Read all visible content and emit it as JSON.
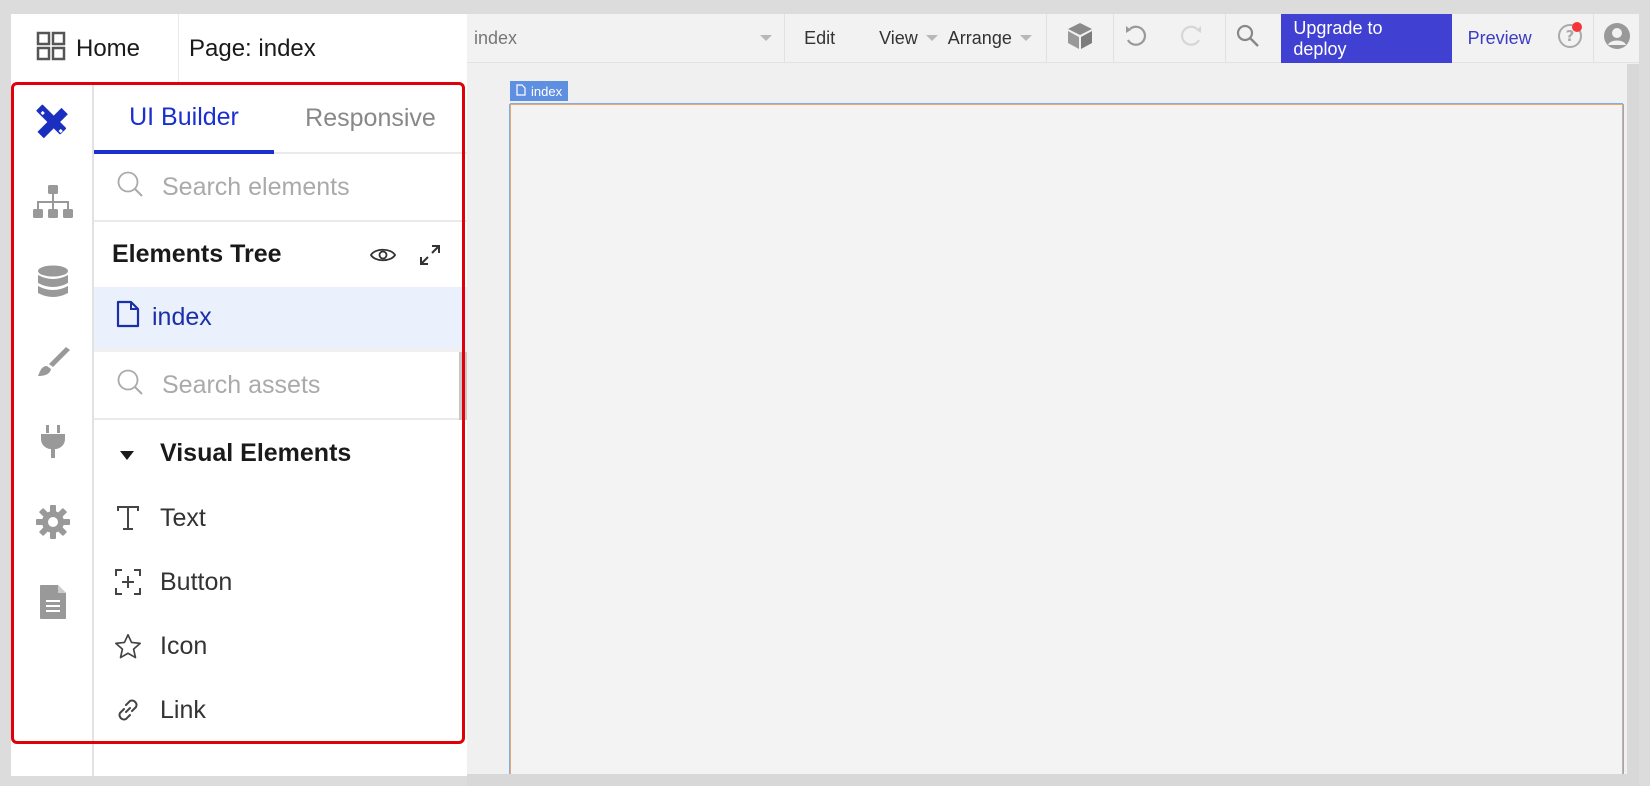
{
  "header": {
    "home_label": "Home",
    "page_title": "Page: index"
  },
  "toolbar": {
    "page_select_value": "index",
    "edit_label": "Edit",
    "view_label": "View",
    "arrange_label": "Arrange",
    "upgrade_label": "Upgrade to deploy",
    "preview_label": "Preview",
    "upgrade_color": "#4040d2",
    "notification_color": "#f4353c"
  },
  "rail": {
    "items": [
      {
        "name": "design",
        "icon": "pencil-ruler-icon",
        "active": true
      },
      {
        "name": "workflow",
        "icon": "sitemap-icon",
        "active": false
      },
      {
        "name": "data",
        "icon": "database-icon",
        "active": false
      },
      {
        "name": "styles",
        "icon": "paintbrush-icon",
        "active": false
      },
      {
        "name": "plugins",
        "icon": "plug-icon",
        "active": false
      },
      {
        "name": "settings",
        "icon": "gear-icon",
        "active": false
      },
      {
        "name": "logs",
        "icon": "document-icon",
        "active": false
      }
    ]
  },
  "panel": {
    "tabs": [
      {
        "label": "UI Builder",
        "active": true
      },
      {
        "label": "Responsive",
        "active": false
      }
    ],
    "search_elements_placeholder": "Search elements",
    "tree_title": "Elements Tree",
    "tree_items": [
      {
        "label": "index",
        "selected": true
      }
    ],
    "search_assets_placeholder": "Search assets",
    "section_title": "Visual Elements",
    "assets": [
      {
        "label": "Text",
        "icon": "text-icon"
      },
      {
        "label": "Button",
        "icon": "button-icon"
      },
      {
        "label": "Icon",
        "icon": "star-icon"
      },
      {
        "label": "Link",
        "icon": "link-icon"
      }
    ]
  },
  "canvas": {
    "page_label": "index"
  },
  "accent_color": "#1a2fd0",
  "highlight_color": "#e0000a"
}
